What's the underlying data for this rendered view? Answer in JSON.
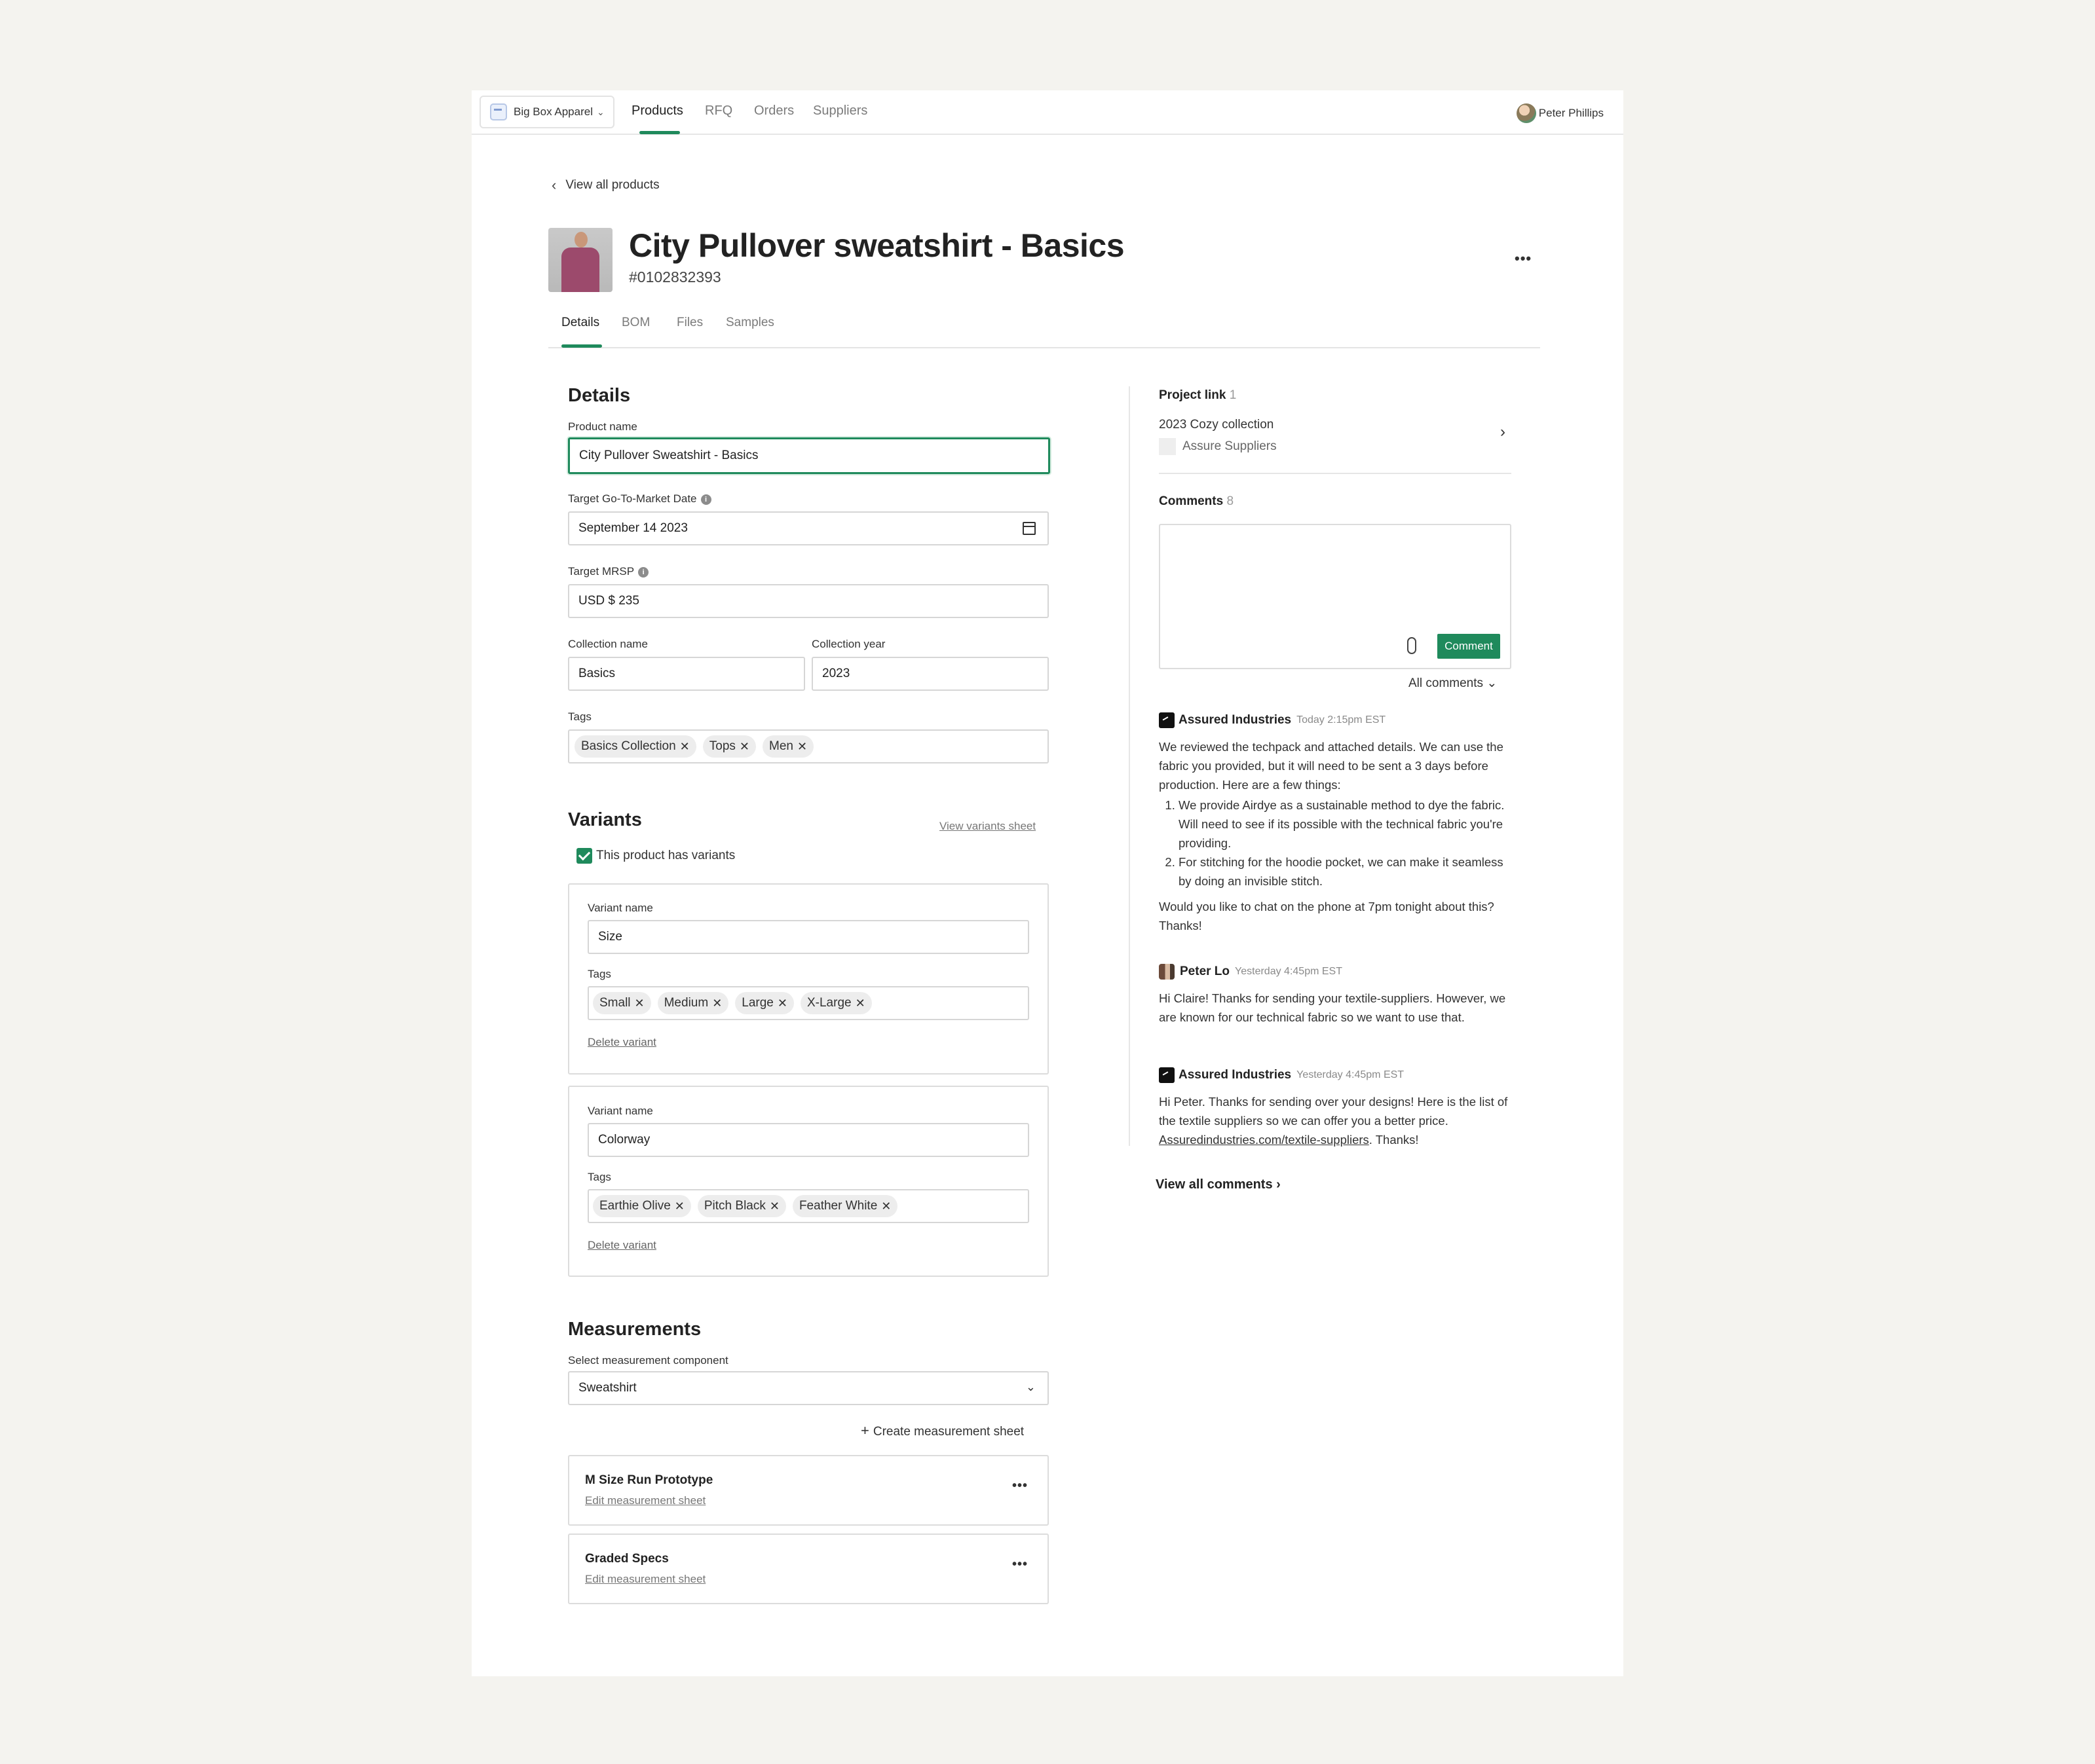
{
  "nav": {
    "org": "Big Box Apparel",
    "tabs": [
      "Products",
      "RFQ",
      "Orders",
      "Suppliers"
    ],
    "user": "Peter Phillips"
  },
  "header": {
    "back": "View all products",
    "title": "City Pullover sweatshirt - Basics",
    "sku": "#0102832393",
    "tabs": [
      "Details",
      "BOM",
      "Files",
      "Samples"
    ]
  },
  "details": {
    "heading": "Details",
    "product_name_label": "Product name",
    "product_name": "City Pullover Sweatshirt - Basics",
    "gtm_label": "Target Go-To-Market Date",
    "gtm": "September 14 2023",
    "mrsp_label": "Target MRSP",
    "mrsp": "USD $ 235",
    "collection_name_label": "Collection name",
    "collection_name": "Basics",
    "collection_year_label": "Collection year",
    "collection_year": "2023",
    "tags_label": "Tags",
    "tags": [
      "Basics Collection",
      "Tops",
      "Men"
    ]
  },
  "variants": {
    "heading": "Variants",
    "sheet_link": "View variants sheet",
    "has_variants": "This product has variants",
    "items": [
      {
        "name_label": "Variant name",
        "name": "Size",
        "tags_label": "Tags",
        "tags": [
          "Small",
          "Medium",
          "Large",
          "X-Large"
        ],
        "delete": "Delete variant"
      },
      {
        "name_label": "Variant name",
        "name": "Colorway",
        "tags_label": "Tags",
        "tags": [
          "Earthie Olive",
          "Pitch Black",
          "Feather White"
        ],
        "delete": "Delete variant"
      }
    ]
  },
  "measurements": {
    "heading": "Measurements",
    "select_label": "Select measurement component",
    "selected": "Sweatshirt",
    "create": "Create measurement sheet",
    "sheets": [
      {
        "title": "M Size Run Prototype",
        "edit": "Edit measurement sheet"
      },
      {
        "title": "Graded Specs",
        "edit": "Edit measurement sheet"
      }
    ]
  },
  "project": {
    "heading": "Project link",
    "count": "1",
    "name": "2023 Cozy collection",
    "supplier": "Assure Suppliers"
  },
  "comments": {
    "heading": "Comments",
    "count": "8",
    "button": "Comment",
    "filter": "All comments",
    "items": [
      {
        "author": "Assured Industries",
        "time": "Today 2:15pm EST",
        "intro": "We reviewed the techpack and attached details. We can use the fabric you provided, but it will need to be sent a 3 days before production. Here are a few things:",
        "list": [
          "We provide Airdye as a sustainable method to dye the fabric. Will need to see if its possible with the technical fabric you're providing.",
          "For stitching for the hoodie pocket, we can make it seamless by doing an invisible stitch."
        ],
        "outro": "Would you like to chat on the phone at 7pm tonight about this? Thanks!"
      },
      {
        "author": "Peter Lo",
        "time": "Yesterday 4:45pm EST",
        "text": "Hi Claire! Thanks for sending your textile-suppliers. However, we are known for our technical fabric so we want to use that."
      },
      {
        "author": "Assured Industries",
        "time": "Yesterday 4:45pm EST",
        "text_before": "Hi Peter. Thanks for sending over your designs! Here is the list of the textile suppliers so we can offer you a better price. ",
        "link": "Assuredindustries.com/textile-suppliers",
        "text_after": ". Thanks!"
      }
    ],
    "view_all": "View all comments"
  }
}
